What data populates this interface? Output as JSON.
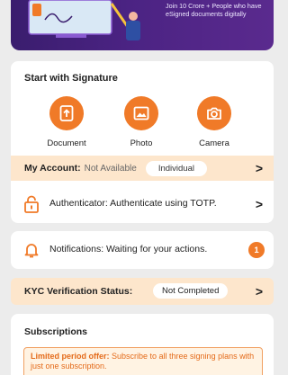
{
  "banner": {
    "line1": "Join 10 Crore + People who have",
    "line2": "eSigned documents digitally"
  },
  "signature": {
    "title": "Start with Signature",
    "actions": [
      {
        "label": "Document",
        "icon": "document-upload-icon"
      },
      {
        "label": "Photo",
        "icon": "photo-icon"
      },
      {
        "label": "Camera",
        "icon": "camera-icon"
      }
    ]
  },
  "account": {
    "label": "My Account:",
    "status": "Not Available",
    "type": "Individual"
  },
  "authenticator": {
    "label": "Authenticator:",
    "text": "Authenticate using TOTP."
  },
  "notifications": {
    "label": "Notifications:",
    "text": "Waiting for your actions.",
    "count": "1"
  },
  "kyc": {
    "label": "KYC Verification Status:",
    "status": "Not Completed"
  },
  "subscriptions": {
    "title": "Subscriptions",
    "offer_bold": "Limited period offer:",
    "offer_text": " Subscribe to all three signing plans with just one subscription."
  },
  "colors": {
    "accent": "#f07a28",
    "banner": "#4b2383",
    "highlight_bg": "#fde6cc"
  }
}
